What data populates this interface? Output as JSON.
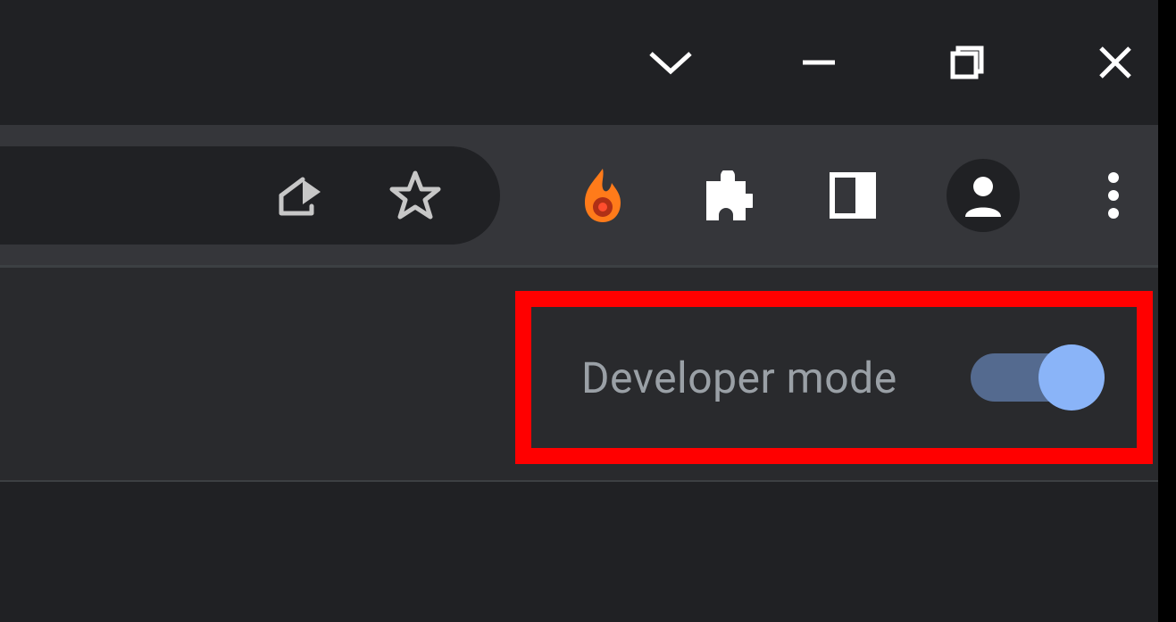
{
  "window_controls": {
    "search_tabs_icon": "chevron-down",
    "minimize_icon": "minimize",
    "maximize_icon": "maximize",
    "close_icon": "close"
  },
  "omnibox": {
    "share_icon": "share",
    "bookmark_icon": "star"
  },
  "toolbar": {
    "extension_pinned_icon": "flame",
    "extensions_icon": "puzzle",
    "side_panel_icon": "panel",
    "profile_icon": "person",
    "menu_icon": "kebab"
  },
  "page": {
    "developer_mode_label": "Developer mode",
    "developer_mode_on": true
  },
  "highlight": {
    "color": "#ff0000"
  }
}
